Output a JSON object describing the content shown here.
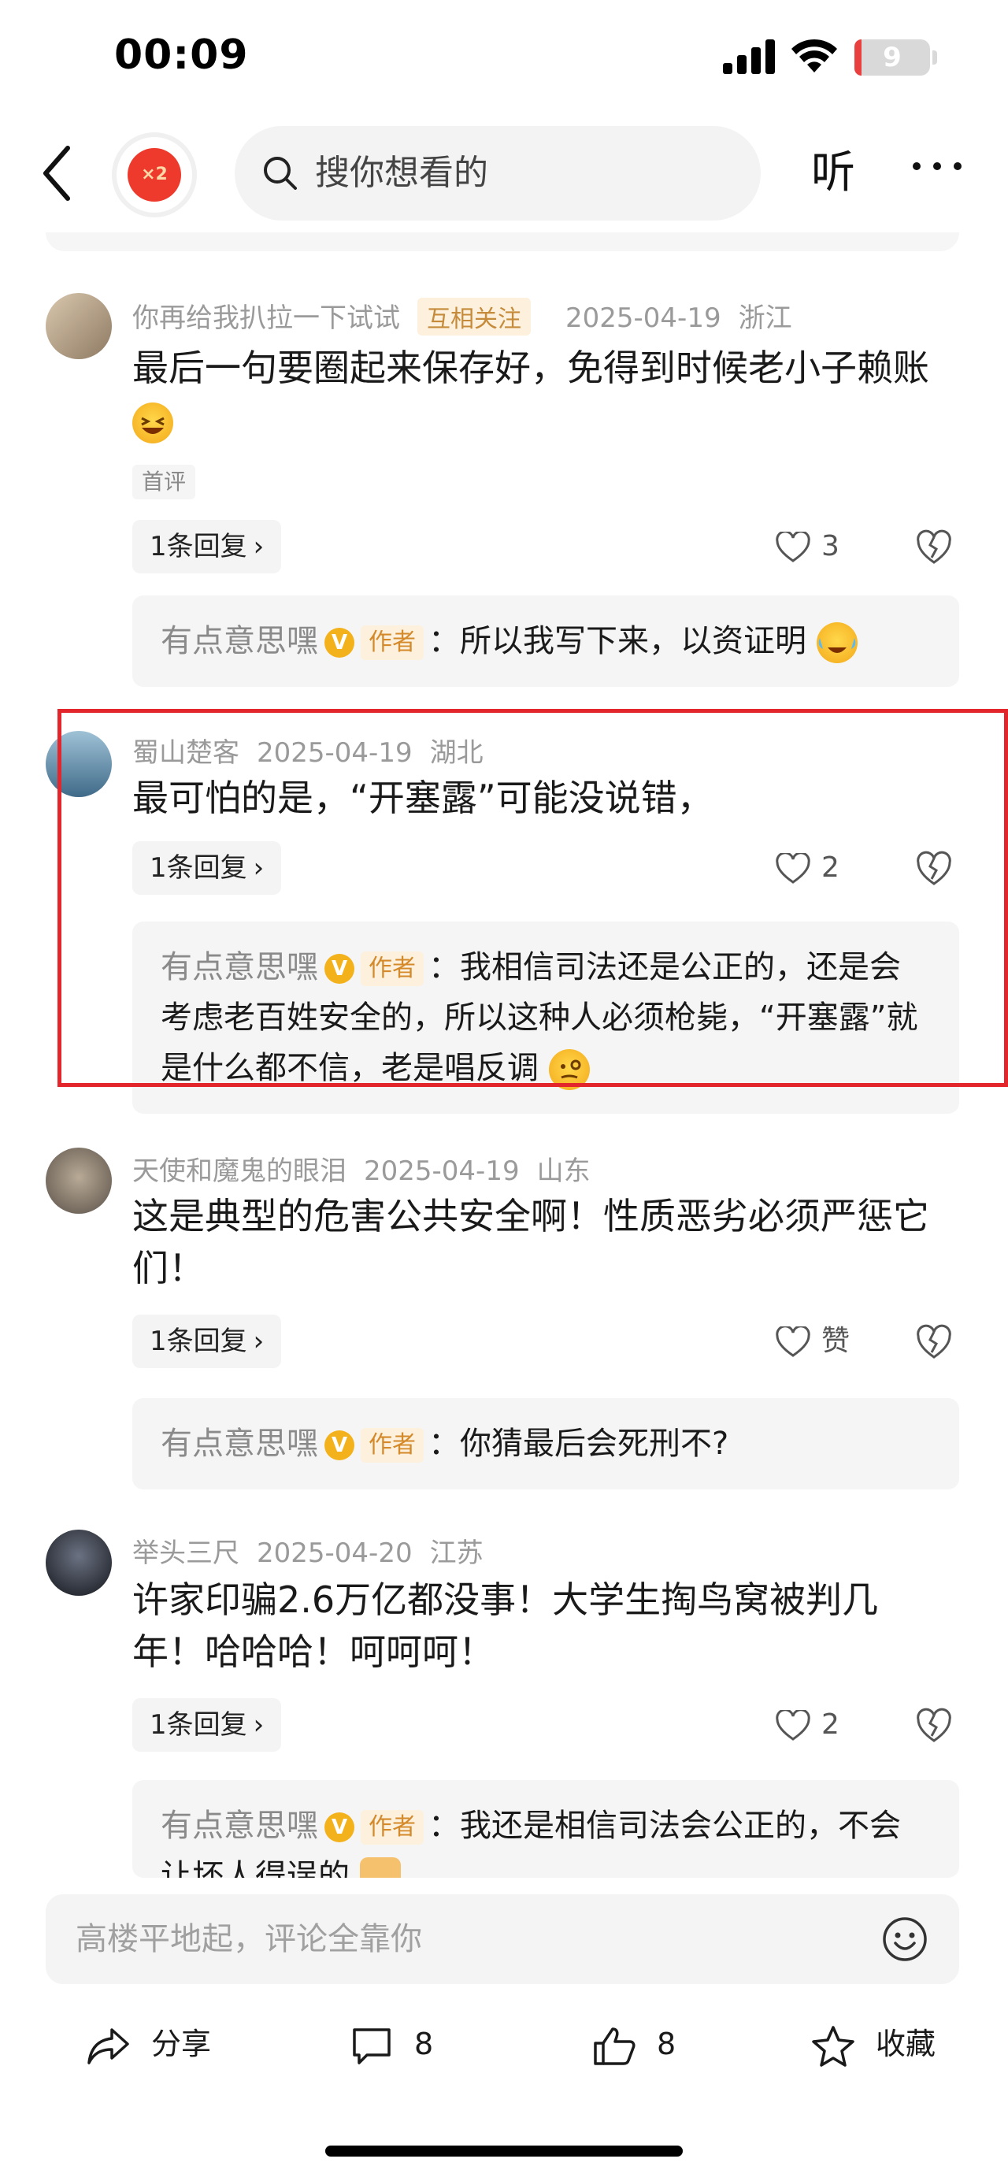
{
  "status": {
    "time": "00:09",
    "battery": "9",
    "battery_level": 0.09
  },
  "nav": {
    "search_placeholder": "搜你想看的",
    "listen_label": "听",
    "gift_badge": "×2"
  },
  "comments": [
    {
      "user": "你再给我扒拉一下试试",
      "mutual_tag": "互相关注",
      "date": "2025-04-19",
      "region": "浙江",
      "text": "最后一句要圈起来保存好，免得到时候老小子赖账",
      "first_tag": "首评",
      "reply_label": "1条回复",
      "likes": "3",
      "reply": {
        "author": "有点意思嘿",
        "author_tag": "作者",
        "badge": "V",
        "text": "：所以我写下来，以资证明"
      }
    },
    {
      "user": "蜀山楚客",
      "date": "2025-04-19",
      "region": "湖北",
      "text": "最可怕的是，“开塞露”可能没说错，",
      "reply_label": "1条回复",
      "likes": "2",
      "reply": {
        "author": "有点意思嘿",
        "author_tag": "作者",
        "badge": "V",
        "text": "：我相信司法还是公正的，还是会考虑老百姓安全的，所以这种人必须枪毙，“开塞露”就是什么都不信，老是唱反调"
      }
    },
    {
      "user": "天使和魔鬼的眼泪",
      "date": "2025-04-19",
      "region": "山东",
      "text": "这是典型的危害公共安全啊！性质恶劣必须严惩它们！",
      "reply_label": "1条回复",
      "likes": "赞",
      "reply": {
        "author": "有点意思嘿",
        "author_tag": "作者",
        "badge": "V",
        "text": "：你猜最后会死刑不?"
      }
    },
    {
      "user": "举头三尺",
      "date": "2025-04-20",
      "region": "江苏",
      "text": "许家印骗2.6万亿都没事！大学生掏鸟窝被判几年！哈哈哈！呵呵呵！",
      "reply_label": "1条回复",
      "likes": "2",
      "reply": {
        "author": "有点意思嘿",
        "author_tag": "作者",
        "badge": "V",
        "text": "：我还是相信司法会公正的，不会让坏人得逞的"
      }
    }
  ],
  "input": {
    "placeholder": "高楼平地起，评论全靠你"
  },
  "actions": {
    "share": "分享",
    "comments": "8",
    "likes": "8",
    "favorite": "收藏"
  },
  "colors": {
    "accent_red": "#e3262b",
    "tag_bg": "#fdf0dc",
    "tag_text": "#d48a2a"
  }
}
